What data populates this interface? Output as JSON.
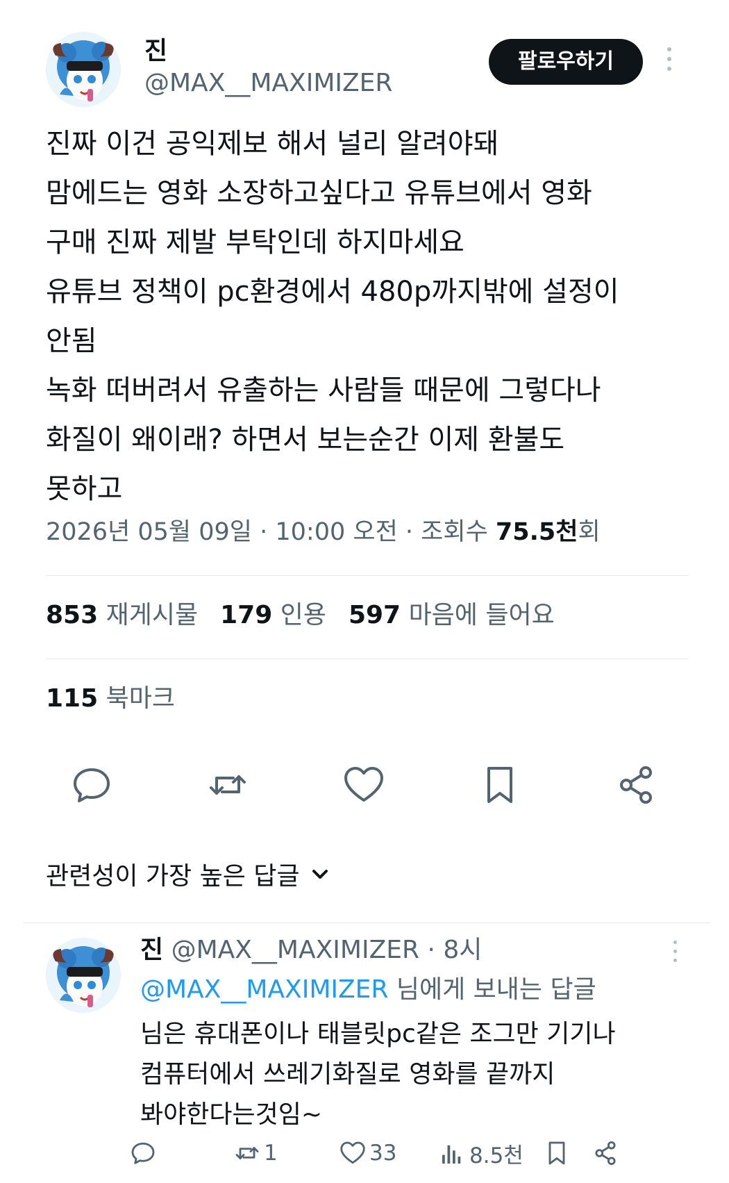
{
  "author": {
    "display_name": "진",
    "handle": "@MAX__MAXIMIZER"
  },
  "follow_label": "팔로우하기",
  "tweet": {
    "lines": [
      "진짜 이건 공익제보 해서 널리 알려야돼",
      "맘에드는 영화 소장하고싶다고 유튜브에서 영화",
      "구매 진짜 제발 부탁인데 하지마세요",
      "유튜브 정책이 pc환경에서 480p까지밖에 설정이",
      "안됨",
      "녹화 떠버려서 유출하는 사람들 때문에 그렇다나",
      "화질이 왜이래? 하면서 보는순간 이제 환불도",
      "못하고"
    ],
    "date": "2026년 05월 09일",
    "time": "10:00 오전",
    "views_label": "조회수",
    "views_count": "75.5천",
    "views_suffix": "회"
  },
  "stats": {
    "reposts_count": "853",
    "reposts_label": "재게시물",
    "quotes_count": "179",
    "quotes_label": "인용",
    "likes_count": "597",
    "likes_label": "마음에 들어요",
    "bookmarks_count": "115",
    "bookmarks_label": "북마크"
  },
  "actions": [
    "reply-icon",
    "repost-icon",
    "like-icon",
    "bookmark-icon",
    "share-icon"
  ],
  "replies_sort_label": "관련성이 가장 높은 답글",
  "reply": {
    "display_name": "진",
    "handle": "@MAX__MAXIMIZER",
    "time": "8시",
    "reply_to_mention": "@MAX__MAXIMIZER",
    "reply_to_suffix": "님에게 보내는 답글",
    "lines": [
      "님은 휴대폰이나 태블릿pc같은 조그만 기기나",
      "컴퓨터에서 쓰레기화질로 영화를 끝까지",
      "봐야한다는것임~"
    ],
    "reposts": "1",
    "likes": "33",
    "views": "8.5천"
  },
  "colors": {
    "text": "#0f1419",
    "secondary": "#536471",
    "link": "#1d9bf0",
    "divider": "#e6e9ec"
  }
}
